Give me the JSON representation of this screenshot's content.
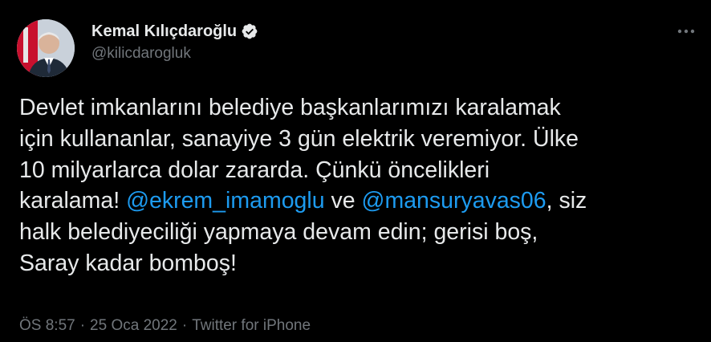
{
  "author": {
    "display_name": "Kemal Kılıçdaroğlu",
    "handle": "@kilicdarogluk",
    "verified": true
  },
  "tweet": {
    "lines": [
      [
        "Devlet imkanlarını belediye başkanlarımızı karalamak"
      ],
      [
        "için kullananlar, sanayiye 3 gün elektrik veremiyor. Ülke"
      ],
      [
        "10 milyarlarca dolar zararda. Çünkü öncelikleri"
      ],
      [
        "karalama! ",
        "@ekrem_imamoglu",
        " ve ",
        "@mansuryavas06",
        ", siz"
      ],
      [
        "halk belediyeciliği yapmaya devam edin; gerisi boş,"
      ],
      [
        "Saray kadar bomboş!"
      ]
    ]
  },
  "meta": {
    "time": "ÖS 8:57",
    "separator": "·",
    "date": "25 Oca 2022",
    "source": "Twitter for iPhone"
  },
  "colors": {
    "background": "#000000",
    "text": "#e7e9ea",
    "secondary": "#71767b",
    "link": "#1d9bf0"
  },
  "icons": {
    "verified": "verified-badge-icon",
    "more": "more-options-icon"
  }
}
